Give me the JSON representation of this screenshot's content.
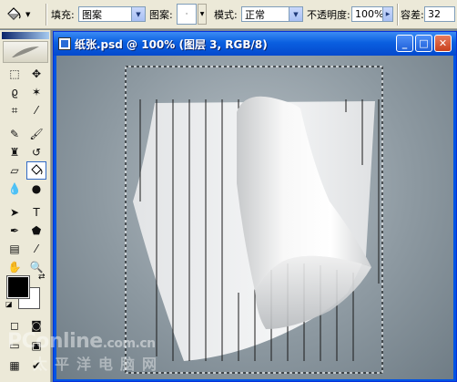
{
  "options_bar": {
    "fill_label": "填充:",
    "fill_value": "图案",
    "pattern_label": "图案:",
    "mode_label": "模式:",
    "mode_value": "正常",
    "opacity_label": "不透明度:",
    "opacity_value": "100%",
    "tolerance_label": "容差:",
    "tolerance_value": "32"
  },
  "document": {
    "title": "纸张.psd @ 100% (图层 3, RGB/8)"
  },
  "watermark": {
    "text": "PConline",
    "domain": ".com.cn",
    "cn": "太平洋电脑网"
  },
  "icons": {
    "tool_preset": "paint-bucket-icon",
    "active_tool": "paint-bucket-icon"
  },
  "colors": {
    "foreground": "#000000",
    "background": "#ffffff",
    "titlebar": "#0a5fe0"
  }
}
